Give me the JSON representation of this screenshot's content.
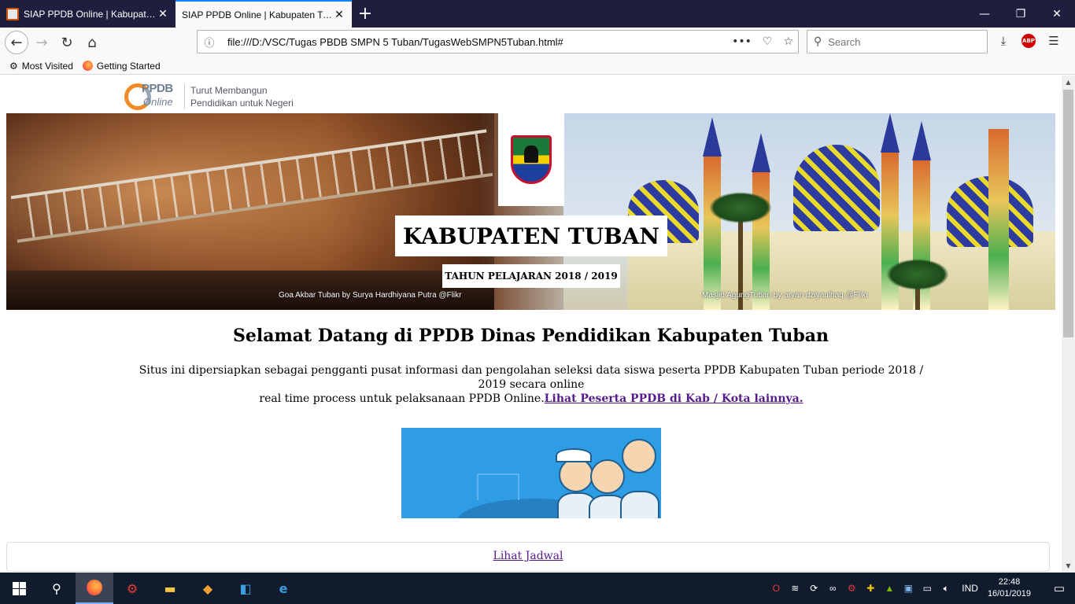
{
  "browser": {
    "tabs": [
      {
        "label": "SIAP PPDB Online | Kabupaten Tuban",
        "active": false
      },
      {
        "label": "SIAP PPDB Online | Kabupaten Tuban",
        "active": true
      }
    ],
    "url": "file:///D:/VSC/Tugas PBDB SMPN 5 Tuban/TugasWebSMPN5Tuban.html#",
    "search_placeholder": "Search",
    "bookmarks": [
      {
        "label": "Most Visited",
        "icon": "gear-icon"
      },
      {
        "label": "Getting Started",
        "icon": "firefox-icon"
      }
    ],
    "abp_label": "ABP"
  },
  "page": {
    "logo": {
      "brand_ppdb": "PPDB",
      "brand_online": "Online",
      "tagline_line1": "Turut Membangun",
      "tagline_line2": "Pendidikan untuk Negeri"
    },
    "banner": {
      "title": "KABUPATEN TUBAN",
      "subtitle": "TAHUN PELAJARAN 2018 / 2019",
      "credit_left": "Goa Akbar Tuban by Surya Hardhiyana Putra  @Flikr",
      "credit_right": "Masjid AgungTuban by aryan dziyaulhaq @Flikr"
    },
    "welcome_heading": "Selamat Datang di PPDB Dinas Pendidikan Kabupaten Tuban",
    "description_line1": "Situs ini dipersiapkan sebagai pengganti pusat informasi dan pengolahan seleksi data siswa peserta PPDB Kabupaten Tuban periode 2018 / 2019 secara online",
    "description_line2": "real time process untuk pelaksanaan PPDB Online.",
    "description_link": "Lihat Peserta PPDB di Kab / Kota lainnya.",
    "schedule_link": "Lihat Jadwal"
  },
  "taskbar": {
    "language": "IND",
    "time": "22:48",
    "date": "16/01/2019"
  }
}
